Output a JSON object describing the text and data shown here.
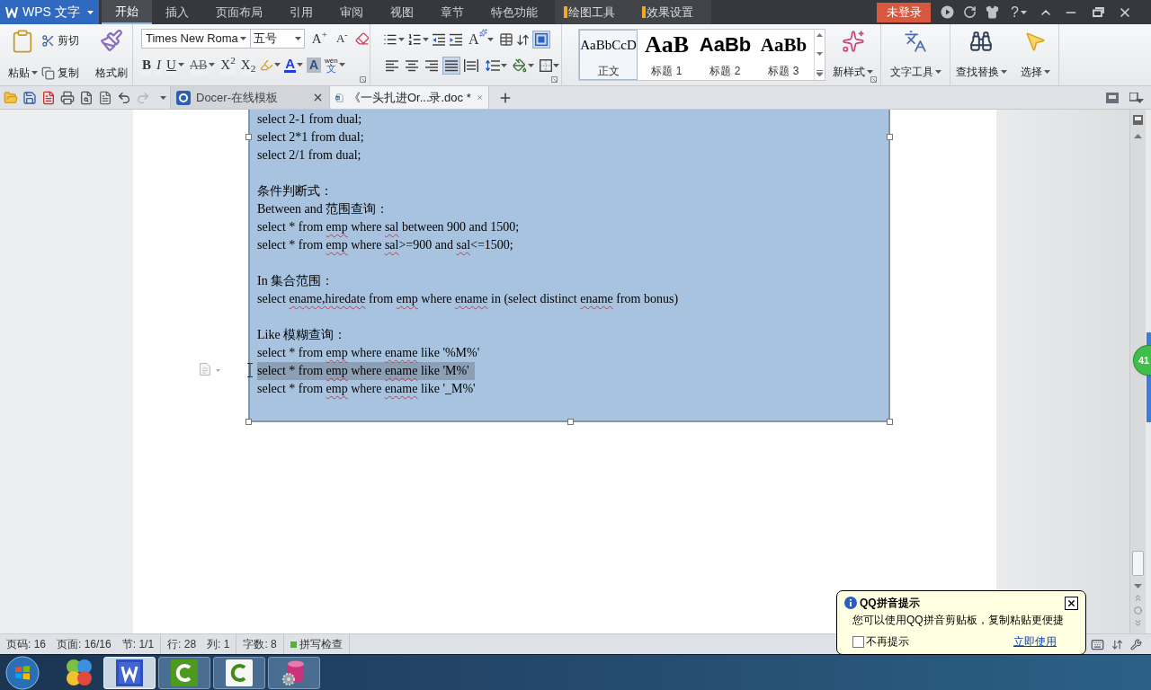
{
  "title_bar": {
    "app_button": {
      "label": "WPS 文字"
    },
    "tabs": [
      {
        "label": "开始",
        "selected": true
      },
      {
        "label": "插入",
        "selected": false
      },
      {
        "label": "页面布局",
        "selected": false
      },
      {
        "label": "引用",
        "selected": false
      },
      {
        "label": "审阅",
        "selected": false
      },
      {
        "label": "视图",
        "selected": false
      },
      {
        "label": "章节",
        "selected": false
      },
      {
        "label": "特色功能",
        "selected": false
      }
    ],
    "context_tabs": [
      {
        "label": "绘图工具",
        "selected": false
      },
      {
        "label": "效果设置",
        "selected": false
      }
    ],
    "login_label": "未登录",
    "help_label": "?"
  },
  "ribbon": {
    "clipboard": {
      "paste": "粘贴",
      "cut": "剪切",
      "copy": "复制",
      "format_painter": "格式刷"
    },
    "font": {
      "name": "Times New Roma",
      "size": "五号",
      "grow": "A$^{+}$",
      "shrink": "A$^{-}$",
      "color_label": "A",
      "shading_label": "A",
      "phonetic_ruby": "wén",
      "phonetic_base": "文"
    },
    "format_buttons": [
      {
        "label": "B",
        "kind": "bold",
        "dropdown": false
      },
      {
        "label": "I",
        "kind": "italic",
        "dropdown": false
      },
      {
        "label": "U",
        "kind": "underline",
        "dropdown": true
      },
      {
        "label": "AB",
        "kind": "strike",
        "dropdown": true
      },
      {
        "label": "X$^{2}$",
        "kind": "superscript",
        "dropdown": false
      },
      {
        "label": "X$_{2}$",
        "kind": "subscript",
        "dropdown": false
      }
    ],
    "paragraph": {
      "text_effect_label": "A",
      "align": [
        {
          "kind": "left",
          "selected": false
        },
        {
          "kind": "center",
          "selected": false
        },
        {
          "kind": "right",
          "selected": false
        },
        {
          "kind": "justify",
          "selected": true
        },
        {
          "kind": "distributed",
          "selected": false
        }
      ],
      "frame_toggle": {
        "selected": true
      }
    },
    "styles": [
      {
        "preview": "AaBbCcD",
        "label": "正文",
        "kind": "body",
        "selected": true
      },
      {
        "preview": "AaB",
        "label": "标题 1",
        "kind": "heading1",
        "selected": false
      },
      {
        "preview": "AaBb",
        "label": "标题 2",
        "kind": "heading2",
        "selected": false
      },
      {
        "preview": "AaBb",
        "label": "标题 3",
        "kind": "heading3",
        "selected": false
      }
    ],
    "tools": [
      {
        "label": "新样式",
        "kind": "new-style"
      },
      {
        "label": "文字工具",
        "kind": "text-tools"
      },
      {
        "label": "查找替换",
        "kind": "find-replace"
      },
      {
        "label": "选择",
        "kind": "select"
      }
    ]
  },
  "quick_access": {
    "redo_disabled": true
  },
  "doc_tabs": [
    {
      "label": "Docer-在线模板",
      "kind": "template",
      "selected": false
    },
    {
      "label": "《一头扎进Or...录.doc *",
      "kind": "document",
      "selected": true
    }
  ],
  "document": {
    "blocks": [
      {
        "lines": [
          {
            "selected": false,
            "segments": [
              {
                "text": "select 2-1 from dual;",
                "misspelled": false
              }
            ]
          },
          {
            "selected": false,
            "segments": [
              {
                "text": "select 2*1 from dual;",
                "misspelled": false
              }
            ]
          },
          {
            "selected": false,
            "segments": [
              {
                "text": "select 2/1 from dual;",
                "misspelled": false
              }
            ]
          }
        ]
      },
      {
        "lines": [
          {
            "selected": false,
            "segments": [
              {
                "text": "条件判断式：",
                "misspelled": false
              }
            ]
          },
          {
            "selected": false,
            "segments": [
              {
                "text": "Between and 范围查询：",
                "misspelled": false
              }
            ]
          },
          {
            "selected": false,
            "segments": [
              {
                "text": "select * from ",
                "misspelled": false
              },
              {
                "text": "emp",
                "misspelled": true
              },
              {
                "text": " where ",
                "misspelled": false
              },
              {
                "text": "sal",
                "misspelled": true
              },
              {
                "text": " between 900 and 1500;",
                "misspelled": false
              }
            ]
          },
          {
            "selected": false,
            "segments": [
              {
                "text": "select * from ",
                "misspelled": false
              },
              {
                "text": "emp",
                "misspelled": true
              },
              {
                "text": " where ",
                "misspelled": false
              },
              {
                "text": "sal",
                "misspelled": true
              },
              {
                "text": ">=900 and ",
                "misspelled": false
              },
              {
                "text": "sal",
                "misspelled": true
              },
              {
                "text": "<=1500;",
                "misspelled": false
              }
            ]
          }
        ]
      },
      {
        "lines": [
          {
            "selected": false,
            "segments": [
              {
                "text": "In 集合范围：",
                "misspelled": false
              }
            ]
          },
          {
            "selected": false,
            "segments": [
              {
                "text": "select ",
                "misspelled": false
              },
              {
                "text": "ename,hiredate",
                "misspelled": true
              },
              {
                "text": " from ",
                "misspelled": false
              },
              {
                "text": "emp",
                "misspelled": true
              },
              {
                "text": " where ",
                "misspelled": false
              },
              {
                "text": "ename",
                "misspelled": true
              },
              {
                "text": " in (select distinct ",
                "misspelled": false
              },
              {
                "text": "ename",
                "misspelled": true
              },
              {
                "text": " from bonus)",
                "misspelled": false
              }
            ]
          }
        ]
      },
      {
        "lines": [
          {
            "selected": false,
            "segments": [
              {
                "text": "Like 模糊查询：",
                "misspelled": false
              }
            ]
          },
          {
            "selected": false,
            "segments": [
              {
                "text": "select * from ",
                "misspelled": false
              },
              {
                "text": "emp",
                "misspelled": true
              },
              {
                "text": " where ",
                "misspelled": false
              },
              {
                "text": "ename",
                "misspelled": true
              },
              {
                "text": " like '%M%'",
                "misspelled": false
              }
            ]
          },
          {
            "selected": true,
            "segments": [
              {
                "text": "select * from ",
                "misspelled": false
              },
              {
                "text": "emp",
                "misspelled": true
              },
              {
                "text": " where ",
                "misspelled": false
              },
              {
                "text": "ename",
                "misspelled": true
              },
              {
                "text": " like 'M%'",
                "misspelled": false
              }
            ]
          },
          {
            "selected": false,
            "segments": [
              {
                "text": "select * from ",
                "misspelled": false
              },
              {
                "text": "emp",
                "misspelled": true
              },
              {
                "text": " where ",
                "misspelled": false
              },
              {
                "text": "ename",
                "misspelled": true
              },
              {
                "text": " like '_M%'",
                "misspelled": false
              }
            ]
          }
        ]
      }
    ]
  },
  "floating_badge": "41",
  "status_bar": {
    "groups": [
      [
        "页码: 16",
        "页面: 16/16",
        "节: 1/1"
      ],
      [
        "行: 28",
        "列: 1"
      ],
      [
        "字数: 8"
      ]
    ],
    "spell_check": {
      "label": "拼写检查",
      "on": true
    }
  },
  "taskbar": {
    "apps": [
      {
        "kind": "circles",
        "running": false,
        "selected": false
      },
      {
        "kind": "w-tile",
        "running": true,
        "selected": true
      },
      {
        "kind": "c-green",
        "running": true,
        "selected": false
      },
      {
        "kind": "c-white",
        "running": true,
        "selected": false
      },
      {
        "kind": "database",
        "running": true,
        "selected": false
      }
    ]
  },
  "notification": {
    "title": "QQ拼音提示",
    "message": "您可以使用QQ拼音剪贴板，复制粘贴更便捷",
    "checkbox": {
      "label": "不再提示",
      "checked": false
    },
    "link": "立即使用"
  }
}
